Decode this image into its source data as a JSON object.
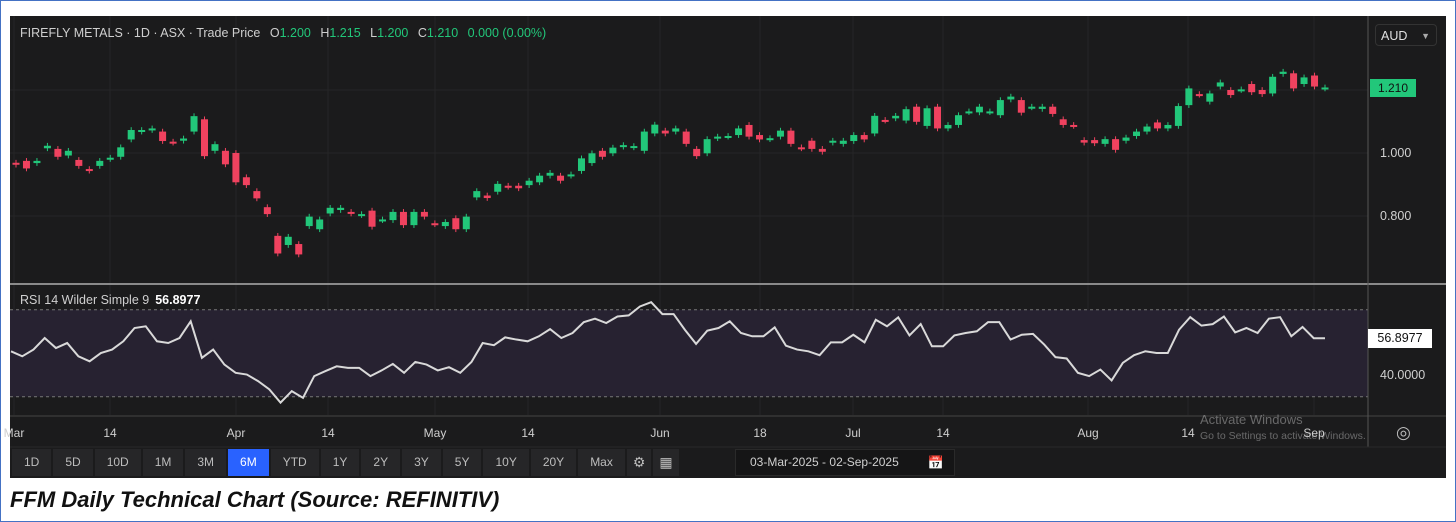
{
  "header": {
    "symbol_line": "FIREFLY METALS · 1D · ASX · Trade Price",
    "o_label": "O",
    "o_value": "1.200",
    "h_label": "H",
    "h_value": "1.215",
    "l_label": "L",
    "l_value": "1.200",
    "c_label": "C",
    "c_value": "1.210",
    "change": "0.000 (0.00%)"
  },
  "currency_select": "AUD",
  "price_axis": {
    "ticks": [
      "1.000",
      "0.800"
    ],
    "last_price": "1.210"
  },
  "rsi": {
    "label": "RSI 14 Wilder Simple 9",
    "value": "56.8977",
    "axis_tick": "40.0000"
  },
  "date_axis": [
    "Mar",
    "14",
    "Apr",
    "14",
    "May",
    "14",
    "Jun",
    "18",
    "Jul",
    "14",
    "Aug",
    "14",
    "Sep"
  ],
  "toolbar": {
    "ranges": [
      "1D",
      "5D",
      "10D",
      "1M",
      "3M",
      "6M",
      "YTD",
      "1Y",
      "2Y",
      "3Y",
      "5Y",
      "10Y",
      "20Y",
      "Max"
    ],
    "active": "6M",
    "date_from": "03-Mar-2025",
    "date_sep": "-",
    "date_to": "02-Sep-2025"
  },
  "watermark": {
    "line1": "Activate Windows",
    "line2": "Go to Settings to activate Windows."
  },
  "caption": "FFM Daily Technical Chart (Source: REFINITIV)",
  "colors": {
    "up": "#22c77a",
    "down": "#f0425f",
    "background": "#1b1b1c",
    "rsi_line": "#d9d9d9",
    "rsi_band": "#272231",
    "active": "#2962ff"
  },
  "chart_data": {
    "type": "candlestick",
    "title": "FIREFLY METALS · 1D · ASX · Trade Price",
    "ylabel": "AUD",
    "ylim": [
      0.62,
      1.33
    ],
    "x_range": [
      "03-Mar-2025",
      "02-Sep-2025"
    ],
    "open": [
      0.969,
      0.975,
      0.968,
      1.015,
      1.013,
      0.992,
      0.978,
      0.949,
      0.959,
      0.981,
      0.988,
      1.043,
      1.068,
      1.073,
      1.068,
      1.036,
      1.039,
      1.068,
      1.107,
      1.007,
      1.007,
      1.0,
      0.923,
      0.879,
      0.828,
      0.737,
      0.708,
      0.711,
      0.768,
      0.758,
      0.808,
      0.819,
      0.813,
      0.803,
      0.817,
      0.787,
      0.787,
      0.813,
      0.771,
      0.813,
      0.777,
      0.768,
      0.793,
      0.758,
      0.859,
      0.865,
      0.877,
      0.896,
      0.896,
      0.898,
      0.907,
      0.928,
      0.928,
      0.928,
      0.943,
      0.968,
      1.007,
      0.999,
      1.02,
      1.018,
      1.007,
      1.062,
      1.071,
      1.068,
      1.068,
      1.013,
      0.999,
      1.047,
      1.052,
      1.057,
      1.089,
      1.057,
      1.044,
      1.052,
      1.071,
      1.018,
      1.039,
      1.013,
      1.033,
      1.029,
      1.038,
      1.057,
      1.062,
      1.105,
      1.11,
      1.103,
      1.147,
      1.086,
      1.147,
      1.078,
      1.089,
      1.13,
      1.129,
      1.13,
      1.12,
      1.17,
      1.168,
      1.145,
      1.14,
      1.147,
      1.107,
      1.089,
      1.041,
      1.041,
      1.029,
      1.044,
      1.039,
      1.054,
      1.068,
      1.097,
      1.078,
      1.086,
      1.152,
      1.187,
      1.163,
      1.211,
      1.2,
      1.2,
      1.219,
      1.2,
      1.189,
      1.251,
      1.253,
      1.219,
      1.246,
      1.205
    ],
    "close": [
      0.963,
      0.951,
      0.975,
      1.023,
      0.988,
      1.007,
      0.959,
      0.944,
      0.975,
      0.985,
      1.018,
      1.073,
      1.073,
      1.078,
      1.038,
      1.033,
      1.046,
      1.117,
      0.99,
      1.028,
      0.964,
      0.907,
      0.898,
      0.856,
      0.806,
      0.681,
      0.734,
      0.678,
      0.798,
      0.789,
      0.826,
      0.826,
      0.808,
      0.806,
      0.766,
      0.789,
      0.813,
      0.771,
      0.813,
      0.798,
      0.774,
      0.781,
      0.758,
      0.798,
      0.879,
      0.857,
      0.902,
      0.893,
      0.888,
      0.912,
      0.928,
      0.937,
      0.912,
      0.932,
      0.983,
      0.999,
      0.988,
      1.017,
      1.025,
      1.022,
      1.068,
      1.09,
      1.062,
      1.078,
      1.029,
      0.99,
      1.044,
      1.052,
      1.054,
      1.078,
      1.052,
      1.043,
      1.047,
      1.071,
      1.029,
      1.015,
      1.013,
      1.004,
      1.039,
      1.039,
      1.057,
      1.043,
      1.118,
      1.103,
      1.118,
      1.139,
      1.099,
      1.142,
      1.078,
      1.089,
      1.12,
      1.132,
      1.147,
      1.132,
      1.168,
      1.179,
      1.128,
      1.147,
      1.147,
      1.124,
      1.089,
      1.086,
      1.033,
      1.031,
      1.044,
      1.01,
      1.049,
      1.068,
      1.084,
      1.078,
      1.089,
      1.149,
      1.205,
      1.185,
      1.189,
      1.224,
      1.184,
      1.202,
      1.193,
      1.187,
      1.242,
      1.258,
      1.205,
      1.24,
      1.211,
      1.208
    ],
    "rsi_ylim": [
      20,
      80
    ],
    "rsi_bands": [
      30,
      70
    ],
    "rsi_values": [
      50.9,
      48.6,
      51.7,
      57.0,
      52.4,
      54.7,
      48.6,
      46.3,
      50.1,
      51.7,
      55.5,
      61.6,
      62.4,
      55.5,
      54.7,
      57.0,
      64.7,
      47.9,
      51.7,
      44.8,
      41.0,
      40.2,
      37.2,
      33.4,
      27.3,
      32.6,
      29.5,
      39.5,
      41.8,
      44.0,
      43.3,
      43.3,
      39.5,
      42.1,
      45.1,
      41.0,
      46.0,
      44.8,
      42.1,
      43.6,
      41.0,
      46.0,
      54.7,
      53.7,
      57.3,
      56.3,
      55.5,
      57.8,
      61.1,
      57.0,
      59.3,
      64.3,
      65.9,
      63.9,
      66.9,
      67.4,
      71.5,
      73.5,
      68.0,
      68.0,
      60.8,
      54.3,
      60.4,
      61.6,
      64.7,
      59.3,
      57.8,
      57.8,
      61.9,
      53.5,
      51.7,
      50.9,
      49.1,
      55.0,
      55.0,
      58.5,
      55.0,
      65.4,
      62.4,
      66.5,
      58.2,
      63.4,
      53.2,
      53.2,
      58.2,
      59.3,
      60.1,
      64.3,
      64.3,
      56.3,
      58.5,
      58.9,
      54.0,
      48.2,
      47.6,
      41.0,
      39.5,
      42.5,
      37.5,
      45.6,
      49.1,
      50.9,
      50.1,
      50.1,
      60.8,
      66.6,
      62.7,
      63.4,
      66.9,
      59.6,
      61.6,
      59.3,
      65.9,
      66.6,
      57.8,
      62.1,
      56.9,
      56.9
    ]
  }
}
